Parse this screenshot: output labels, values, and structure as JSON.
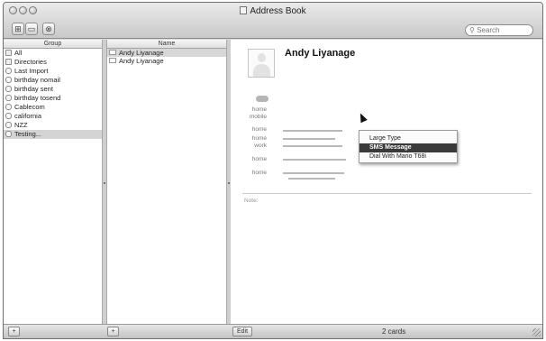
{
  "window": {
    "title": "Address Book"
  },
  "toolbar": {
    "search_placeholder": "Search",
    "view_card_and_columns": "⊞",
    "view_card_only": "▭",
    "close_symbol": "⊗"
  },
  "columns": {
    "group_header": "Group",
    "name_header": "Name"
  },
  "groups": [
    {
      "label": "All",
      "icon": "group-icon"
    },
    {
      "label": "Directories",
      "icon": "directories-icon"
    },
    {
      "label": "Last Import",
      "icon": "smart-group-icon"
    },
    {
      "label": "birthday nomail",
      "icon": "smart-group-icon"
    },
    {
      "label": "birthday sent",
      "icon": "smart-group-icon"
    },
    {
      "label": "birthday tosend",
      "icon": "smart-group-icon"
    },
    {
      "label": "Cablecom",
      "icon": "smart-group-icon"
    },
    {
      "label": "california",
      "icon": "smart-group-icon"
    },
    {
      "label": "NZZ",
      "icon": "smart-group-icon"
    },
    {
      "label": "Testing...",
      "icon": "smart-group-icon",
      "selected": true
    }
  ],
  "names": [
    {
      "label": "Andy Liyanage",
      "selected": true
    },
    {
      "label": "Andy Liyanage",
      "selected": false
    }
  ],
  "card": {
    "name": "Andy Liyanage",
    "field_labels": [
      "home",
      "mobile",
      "home",
      "home",
      "work",
      "home",
      "home"
    ],
    "note_label": "Note:"
  },
  "context_menu": {
    "items": [
      "Large Type",
      "SMS Message",
      "Dial With Mario T68i"
    ],
    "active_index": 1
  },
  "bottom_bar": {
    "add_group": "+",
    "add_person": "+",
    "edit": "Edit",
    "card_count": "2 cards"
  }
}
